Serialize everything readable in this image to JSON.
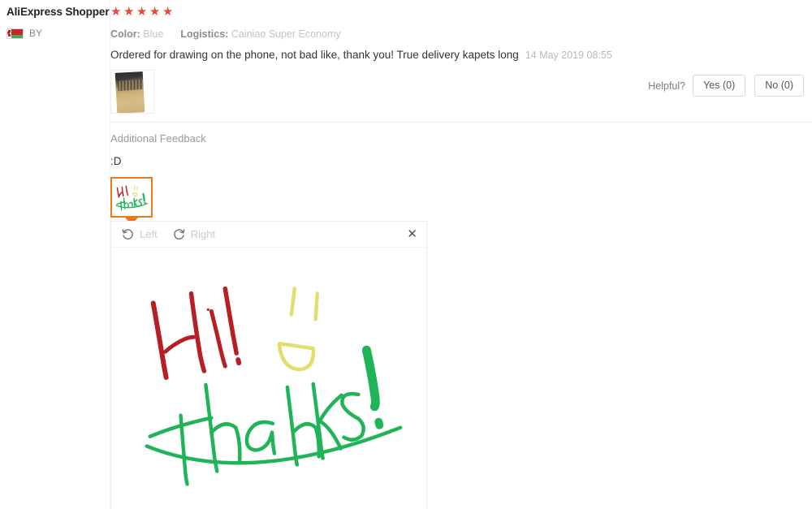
{
  "reviewer": {
    "name": "AliExpress Shopper",
    "country_code": "BY",
    "flag_icon": "flag-belarus-icon",
    "flag_colors": {
      "red": "#cc2229",
      "green": "#4aa657"
    }
  },
  "rating": {
    "stars_filled": 5,
    "stars_total": 5,
    "star_glyph": "★",
    "star_color": "#e8483c"
  },
  "attributes": [
    {
      "label": "Color:",
      "value": "Blue"
    },
    {
      "label": "Logistics:",
      "value": "Cainiao Super Economy"
    }
  ],
  "review": {
    "text": "Ordered for drawing on the phone, not bad like, thank you! True delivery kapets long",
    "date": "14 May 2019 08:55",
    "photo_thumb_name": "review-photo-thumbnail"
  },
  "helpful": {
    "label": "Helpful?",
    "yes_label": "Yes (0)",
    "no_label": "No (0)"
  },
  "additional_feedback": {
    "title": "Additional Feedback",
    "text": ":D",
    "thumb_selected": true,
    "thumb_border_color": "#e8781d"
  },
  "viewer": {
    "rotate_left_label": "Left",
    "rotate_right_label": "Right",
    "close_label": "✕",
    "rotate_left_icon": "rotate-counterclockwise-icon",
    "rotate_right_icon": "rotate-clockwise-icon",
    "close_icon": "close-icon"
  },
  "drawing": {
    "alt": "Handwritten drawing: red \"Hi!\", yellow smiley face, green \"Thanks!\" with underline",
    "colors": {
      "red": "#b81f24",
      "yellow": "#e3dd6d",
      "green": "#1fb457"
    },
    "strokes": [
      {
        "name": "hi-H-left-stroke",
        "color": "#b81f24"
      },
      {
        "name": "hi-H-right-stroke",
        "color": "#b81f24"
      },
      {
        "name": "hi-i-stroke",
        "color": "#b81f24"
      },
      {
        "name": "hi-exclamation-stroke",
        "color": "#b81f24"
      },
      {
        "name": "smiley-eye-left",
        "color": "#e3dd6d"
      },
      {
        "name": "smiley-eye-right",
        "color": "#e3dd6d"
      },
      {
        "name": "smiley-mouth",
        "color": "#e3dd6d"
      },
      {
        "name": "thanks-word",
        "color": "#1fb457"
      },
      {
        "name": "thanks-exclamation",
        "color": "#1fb457"
      },
      {
        "name": "thanks-underline",
        "color": "#1fb457"
      }
    ]
  }
}
